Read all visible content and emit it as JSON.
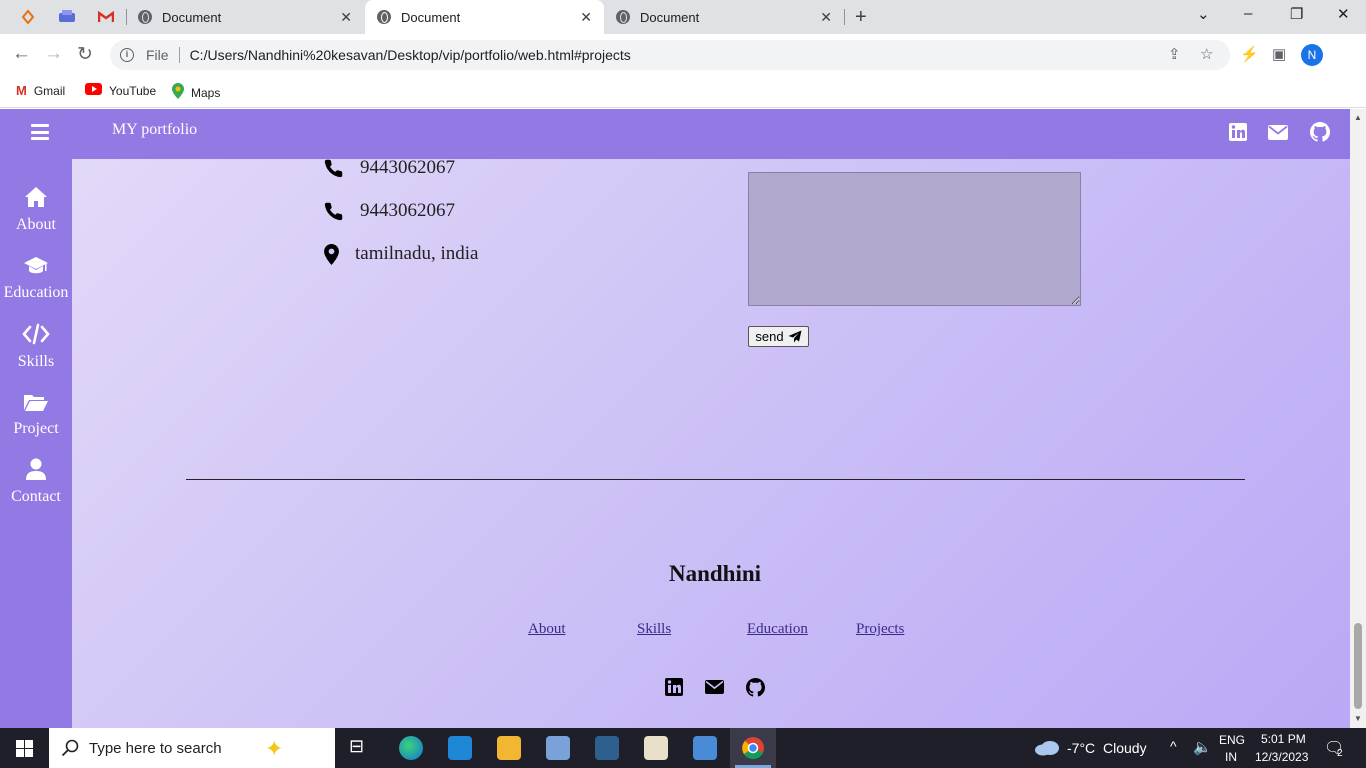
{
  "browser": {
    "tabs": [
      {
        "title": "Document",
        "active": false
      },
      {
        "title": "Document",
        "active": true
      },
      {
        "title": "Document",
        "active": false
      }
    ],
    "url_scheme": "File",
    "url": "C:/Users/Nandhini%20kesavan/Desktop/vip/portfolio/web.html#projects",
    "profile_initial": "N",
    "bookmarks": [
      {
        "label": "Gmail",
        "icon": "gmail-icon"
      },
      {
        "label": "YouTube",
        "icon": "youtube-icon"
      },
      {
        "label": "Maps",
        "icon": "maps-icon"
      }
    ]
  },
  "page": {
    "brand": "MY portfolio",
    "sidebar": [
      {
        "label": "About",
        "icon": "home-icon"
      },
      {
        "label": "Education",
        "icon": "graduation-cap-icon"
      },
      {
        "label": "Skills",
        "icon": "code-icon"
      },
      {
        "label": "Project",
        "icon": "folder-open-icon"
      },
      {
        "label": "Contact",
        "icon": "user-icon"
      }
    ],
    "contact": {
      "phone1": "9443062067",
      "phone2": "9443062067",
      "location": "tamilnadu, india"
    },
    "form": {
      "message_value": "",
      "send_label": "send"
    },
    "footer": {
      "name": "Nandhini",
      "links": [
        "About",
        "Skills",
        "Education",
        "Projects"
      ]
    },
    "social_icons": [
      "linkedin-icon",
      "mail-icon",
      "github-icon"
    ]
  },
  "taskbar": {
    "search_placeholder": "Type here to search",
    "weather_temp": "-7°C",
    "weather_text": "Cloudy",
    "lang_top": "ENG",
    "lang_bottom": "IN",
    "time": "5:01 PM",
    "date": "12/3/2023",
    "notification_count": "2"
  }
}
